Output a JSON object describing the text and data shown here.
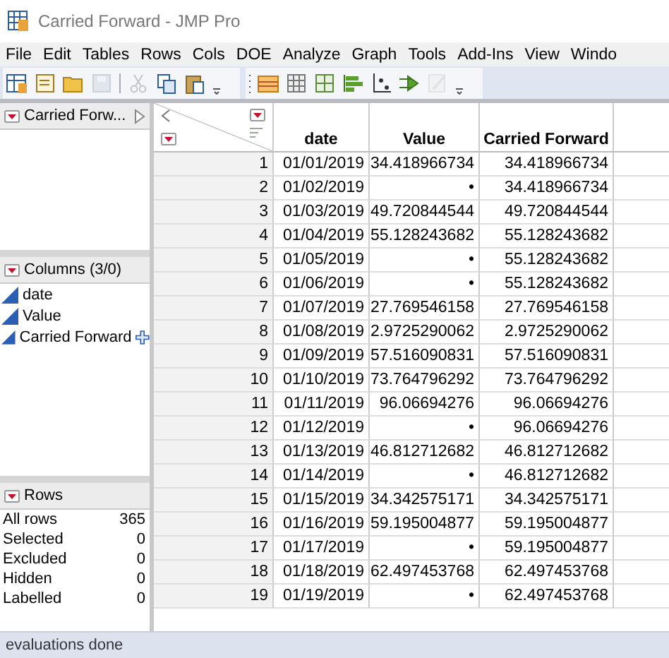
{
  "window": {
    "title": "Carried Forward - JMP Pro"
  },
  "menu": [
    "File",
    "Edit",
    "Tables",
    "Rows",
    "Cols",
    "DOE",
    "Analyze",
    "Graph",
    "Tools",
    "Add-Ins",
    "View",
    "Windo"
  ],
  "toolbar": [
    {
      "kind": "new-table",
      "disabled": false
    },
    {
      "kind": "new-script",
      "disabled": false
    },
    {
      "kind": "open",
      "disabled": false
    },
    {
      "kind": "save",
      "disabled": true
    },
    {
      "kind": "sep",
      "disabled": false
    },
    {
      "kind": "cut",
      "disabled": true
    },
    {
      "kind": "copy",
      "disabled": false
    },
    {
      "kind": "paste",
      "disabled": false
    },
    {
      "kind": "more",
      "disabled": false
    },
    {
      "kind": "grip",
      "disabled": false
    },
    {
      "kind": "data-table",
      "disabled": false
    },
    {
      "kind": "grid",
      "disabled": false
    },
    {
      "kind": "quad",
      "disabled": false
    },
    {
      "kind": "bars",
      "disabled": false
    },
    {
      "kind": "axis",
      "disabled": false
    },
    {
      "kind": "arrow",
      "disabled": false
    },
    {
      "kind": "pencil",
      "disabled": true
    },
    {
      "kind": "more",
      "disabled": false
    }
  ],
  "tables_panel": {
    "title": "Carried Forw..."
  },
  "columns_panel": {
    "title": "Columns (3/0)",
    "items": [
      {
        "name": "date",
        "dragging": false
      },
      {
        "name": "Value",
        "dragging": false
      },
      {
        "name": "Carried Forward",
        "dragging": true
      }
    ]
  },
  "rows_panel": {
    "title": "Rows",
    "stats": [
      {
        "label": "All rows",
        "value": "365"
      },
      {
        "label": "Selected",
        "value": "0"
      },
      {
        "label": "Excluded",
        "value": "0"
      },
      {
        "label": "Hidden",
        "value": "0"
      },
      {
        "label": "Labelled",
        "value": "0"
      }
    ]
  },
  "table": {
    "columns": [
      "",
      "date",
      "Value",
      "Carried Forward"
    ],
    "rows": [
      [
        "1",
        "01/01/2019",
        "34.418966734",
        "34.418966734"
      ],
      [
        "2",
        "01/02/2019",
        "•",
        "34.418966734"
      ],
      [
        "3",
        "01/03/2019",
        "49.720844544",
        "49.720844544"
      ],
      [
        "4",
        "01/04/2019",
        "55.128243682",
        "55.128243682"
      ],
      [
        "5",
        "01/05/2019",
        "•",
        "55.128243682"
      ],
      [
        "6",
        "01/06/2019",
        "•",
        "55.128243682"
      ],
      [
        "7",
        "01/07/2019",
        "27.769546158",
        "27.769546158"
      ],
      [
        "8",
        "01/08/2019",
        "2.9725290062",
        "2.9725290062"
      ],
      [
        "9",
        "01/09/2019",
        "57.516090831",
        "57.516090831"
      ],
      [
        "10",
        "01/10/2019",
        "73.764796292",
        "73.764796292"
      ],
      [
        "11",
        "01/11/2019",
        "96.06694276",
        "96.06694276"
      ],
      [
        "12",
        "01/12/2019",
        "•",
        "96.06694276"
      ],
      [
        "13",
        "01/13/2019",
        "46.812712682",
        "46.812712682"
      ],
      [
        "14",
        "01/14/2019",
        "•",
        "46.812712682"
      ],
      [
        "15",
        "01/15/2019",
        "34.342575171",
        "34.342575171"
      ],
      [
        "16",
        "01/16/2019",
        "59.195004877",
        "59.195004877"
      ],
      [
        "17",
        "01/17/2019",
        "•",
        "59.195004877"
      ],
      [
        "18",
        "01/18/2019",
        "62.497453768",
        "62.497453768"
      ],
      [
        "19",
        "01/19/2019",
        "•",
        "62.497453768"
      ]
    ]
  },
  "status_bar": {
    "text": "evaluations done"
  }
}
